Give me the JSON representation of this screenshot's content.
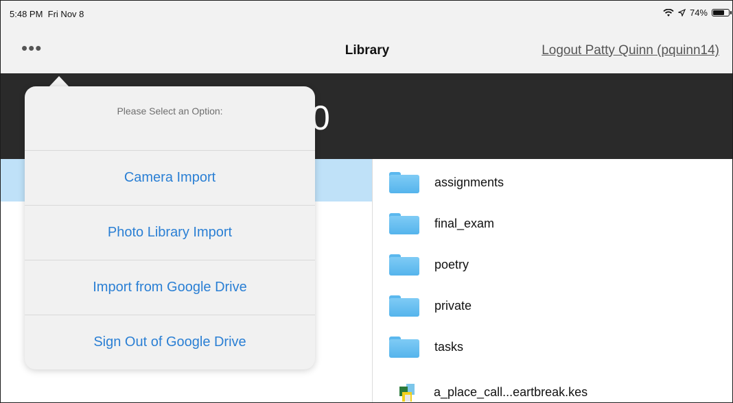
{
  "status_bar": {
    "time": "5:48 PM",
    "date": "Fri Nov 8",
    "battery_percent": "74%",
    "battery_level": 0.74
  },
  "nav": {
    "menu_icon": "ellipsis-icon",
    "title": "Library",
    "logout_label": "Logout Patty Quinn (pquinn14)"
  },
  "header": {
    "number_fragment": "0"
  },
  "popover": {
    "title": "Please Select an Option:",
    "options": [
      "Camera Import",
      "Photo Library Import",
      "Import from Google Drive",
      "Sign Out of Google Drive"
    ]
  },
  "files": [
    {
      "name": "assignments",
      "type": "folder"
    },
    {
      "name": "final_exam",
      "type": "folder"
    },
    {
      "name": "poetry",
      "type": "folder"
    },
    {
      "name": "private",
      "type": "folder"
    },
    {
      "name": "tasks",
      "type": "folder"
    },
    {
      "name": "a_place_call...eartbreak.kes",
      "type": "kes-file"
    }
  ],
  "colors": {
    "accent": "#2a7fd4",
    "folder": "#5bb8ee",
    "selected_row": "#bfe1f8",
    "header_bg": "#2a2a2a"
  }
}
